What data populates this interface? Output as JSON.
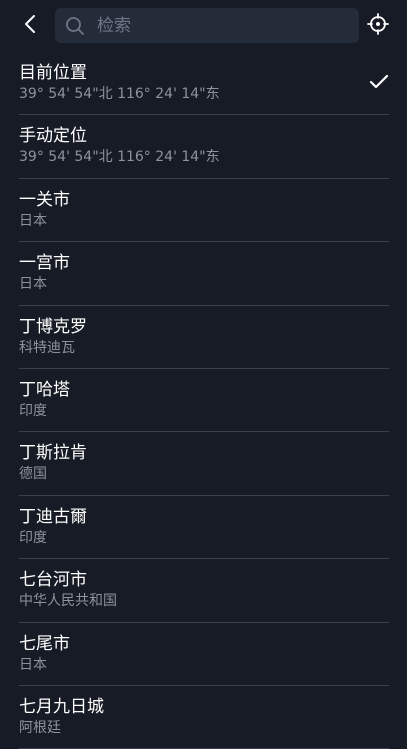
{
  "header": {
    "back_icon": "chevron-left-icon",
    "search": {
      "placeholder": "检索",
      "value": ""
    },
    "locate_icon": "crosshair-icon"
  },
  "locations": [
    {
      "name": "目前位置",
      "detail": "39° 54' 54\"北 116° 24' 14\"东",
      "selected": true
    },
    {
      "name": "手动定位",
      "detail": "39° 54' 54\"北 116° 24' 14\"东",
      "selected": false
    },
    {
      "name": "一关市",
      "detail": "日本",
      "selected": false
    },
    {
      "name": "一宫市",
      "detail": "日本",
      "selected": false
    },
    {
      "name": "丁博克罗",
      "detail": "科特迪瓦",
      "selected": false
    },
    {
      "name": "丁哈塔",
      "detail": "印度",
      "selected": false
    },
    {
      "name": "丁斯拉肯",
      "detail": "德国",
      "selected": false
    },
    {
      "name": "丁迪古爾",
      "detail": "印度",
      "selected": false
    },
    {
      "name": "七台河市",
      "detail": "中华人民共和国",
      "selected": false
    },
    {
      "name": "七尾市",
      "detail": "日本",
      "selected": false
    },
    {
      "name": "七月九日城",
      "detail": "阿根廷",
      "selected": false
    }
  ],
  "colors": {
    "background": "#161b25",
    "search_box": "#242c3a",
    "divider": "#3a404b",
    "secondary_text": "#8d939e"
  }
}
